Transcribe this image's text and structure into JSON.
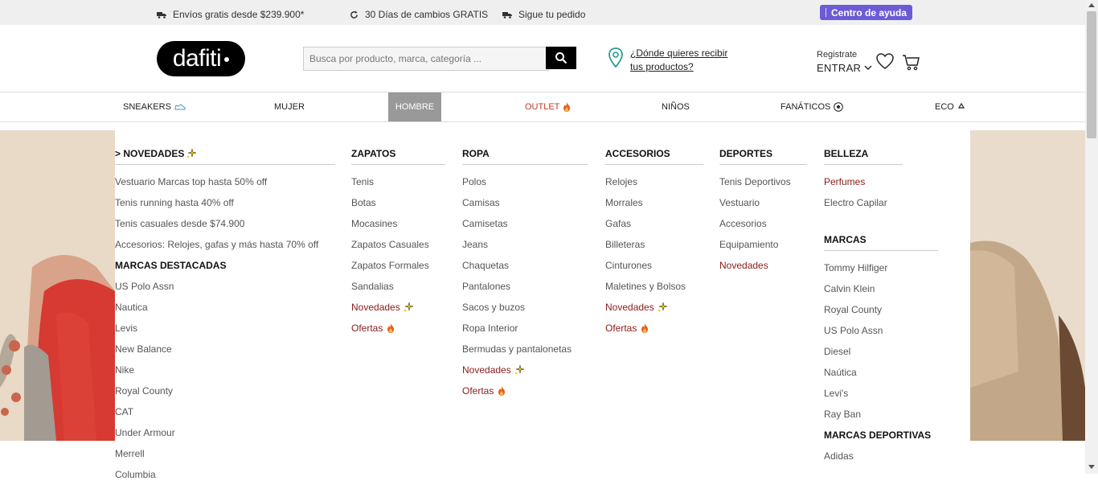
{
  "topbar": {
    "shipping": "Envíos gratis desde $239.900*",
    "returns": "30 Días de cambios GRATIS",
    "tracking": "Sigue tu pedido",
    "help": "Centro de ayuda"
  },
  "header": {
    "logo": "dafiti",
    "search_placeholder": "Busca por producto, marca, categoría ...",
    "location_link": "¿Dónde quieres recibir tus productos?",
    "register": "Registrate",
    "login": "ENTRAR"
  },
  "nav": {
    "sneakers": "SNEAKERS",
    "mujer": "MUJER",
    "hombre": "HOMBRE",
    "outlet": "OUTLET",
    "ninos": "NIÑOS",
    "fanaticos": "FANÁTICOS",
    "eco": "ECO"
  },
  "menu": {
    "novedades": {
      "title": "> NOVEDADES",
      "items": [
        "Vestuario Marcas top hasta 50% off",
        "Tenis running hasta 40% off",
        "Tenis casuales desde $74.900",
        "Accesorios: Relojes, gafas y más hasta 70% off"
      ],
      "brands_title": "MARCAS DESTACADAS",
      "brands": [
        "US Polo Assn",
        "Nautica",
        "Levis",
        "New Balance",
        "Nike",
        "Royal County",
        "CAT",
        "Under Armour",
        "Merrell",
        "Columbia"
      ]
    },
    "zapatos": {
      "title": "ZAPATOS",
      "items": [
        "Tenis",
        "Botas",
        "Mocasines",
        "Zapatos Casuales",
        "Zapatos Formales",
        "Sandalias"
      ],
      "novedades": "Novedades",
      "ofertas": "Ofertas"
    },
    "ropa": {
      "title": "ROPA",
      "items": [
        "Polos",
        "Camisas",
        "Camisetas",
        "Jeans",
        "Chaquetas",
        "Pantalones",
        "Sacos y buzos",
        "Ropa Interior",
        "Bermudas y pantalonetas"
      ],
      "novedades": "Novedades",
      "ofertas": "Ofertas"
    },
    "accesorios": {
      "title": "ACCESORIOS",
      "items": [
        "Relojes",
        "Morrales",
        "Gafas",
        "Billeteras",
        "Cinturones",
        "Maletines y Bolsos"
      ],
      "novedades": "Novedades",
      "ofertas": "Ofertas"
    },
    "deportes": {
      "title": "DEPORTES",
      "items": [
        "Tenis Deportivos",
        "Vestuario",
        "Accesorios",
        "Equipamiento"
      ],
      "novedades": "Novedades"
    },
    "belleza": {
      "title": "BELLEZA",
      "perfumes": "Perfumes",
      "items": [
        "Electro Capilar"
      ],
      "marcas_title": "MARCAS",
      "marcas": [
        "Tommy Hilfiger",
        "Calvin Klein",
        "Royal County",
        "US Polo Assn",
        "Diesel",
        "Naútica",
        "Levi's",
        "Ray Ban"
      ],
      "deportivas_title": "MARCAS DEPORTIVAS",
      "deportivas": [
        "Adidas"
      ]
    }
  },
  "colors": {
    "accent_red": "#8b1a1a",
    "help_button": "#6b5bd6",
    "outlet": "#c0392b",
    "active_tab": "#999999"
  }
}
